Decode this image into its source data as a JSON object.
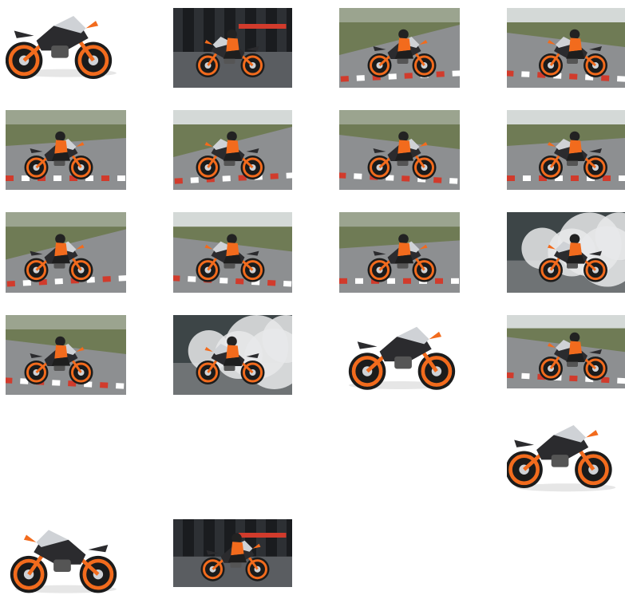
{
  "gallery": {
    "items": [
      {
        "subject": "studio-side",
        "background": "white"
      },
      {
        "subject": "pit-lane-dark",
        "background": "dark"
      },
      {
        "subject": "track-corner-lean",
        "background": "track"
      },
      {
        "subject": "track-closeup-lean",
        "background": "track"
      },
      {
        "subject": "track-lean-left",
        "background": "track"
      },
      {
        "subject": "track-rear-view",
        "background": "track"
      },
      {
        "subject": "track-wheelie",
        "background": "track"
      },
      {
        "subject": "track-front-approach",
        "background": "track"
      },
      {
        "subject": "track-lean-right",
        "background": "track"
      },
      {
        "subject": "track-closeup-corner",
        "background": "track"
      },
      {
        "subject": "track-distance-lean",
        "background": "track"
      },
      {
        "subject": "burnout-smoke-front",
        "background": "smoke"
      },
      {
        "subject": "track-side-ride",
        "background": "track"
      },
      {
        "subject": "burnout-smoke-rear",
        "background": "smoke"
      },
      {
        "subject": "studio-side-right",
        "background": "white"
      },
      {
        "subject": "track-lean-closeup",
        "background": "track"
      },
      {
        "subject": "studio-three-quarter",
        "background": "white"
      },
      {
        "subject": "studio-rear-quarter",
        "background": "white"
      },
      {
        "subject": "pit-lane-dark-2",
        "background": "dark"
      }
    ],
    "colors": {
      "ktm_orange": "#f26b1d",
      "bike_dark": "#2b2b2e",
      "bike_silver": "#cfd2d6",
      "track_gray": "#8d8f91",
      "kerb_red": "#d13b2c",
      "grass_green": "#6f7b55",
      "smoke_white": "#e8e9ea",
      "pit_dark": "#1a1c1f",
      "sky_pale": "#dfe3e5"
    }
  }
}
